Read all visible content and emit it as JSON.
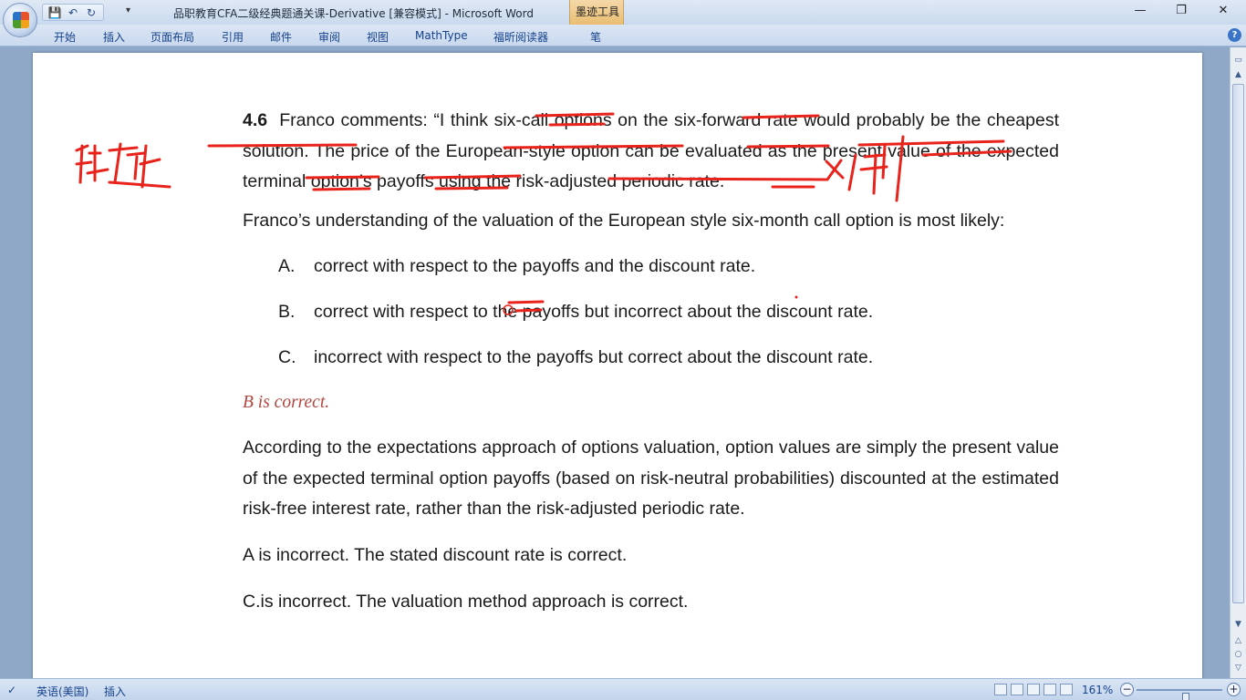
{
  "window": {
    "title": "品职教育CFA二级经典题通关课-Derivative [兼容模式] - Microsoft Word",
    "contextual_tab": "墨迹工具"
  },
  "quick_access": {
    "icons": [
      "save-icon",
      "undo-icon",
      "redo-icon"
    ],
    "more_label": "▾"
  },
  "ribbon": {
    "tabs": [
      "开始",
      "插入",
      "页面布局",
      "引用",
      "邮件",
      "审阅",
      "视图",
      "MathType",
      "福昕阅读器",
      "笔"
    ],
    "help_label": "?"
  },
  "document": {
    "question_number": "4.6",
    "question_text": "Franco comments: “I think six-call options on the six-forward rate would probably be the cheapest solution. The price of the European-style option can be evaluated as the present value of the expected terminal option’s payoffs using the risk-adjusted periodic rate.",
    "prompt": "Franco’s understanding of the valuation of the European style six-month call option is most likely:",
    "options": [
      {
        "label": "A.",
        "text": "correct with respect to the payoffs and the discount rate."
      },
      {
        "label": "B.",
        "text": "correct with respect to the payoffs but incorrect about the discount rate."
      },
      {
        "label": "C.",
        "text": "incorrect with respect to the payoffs but correct about the discount rate."
      }
    ],
    "answer": "B is correct.",
    "explanation": "According to the expectations approach of options valuation, option values are simply the present value of the expected terminal option payoffs (based on risk-neutral probabilities) discounted at the estimated risk-free interest rate, rather than the risk-adjusted periodic rate.",
    "note_a": "A is incorrect. The stated discount rate is correct.",
    "note_c": "C.is incorrect. The valuation method approach is correct."
  },
  "statusbar": {
    "language": "英语(美国)",
    "mode": "插入",
    "zoom": "161%",
    "zoom_fraction": 0.58
  },
  "colors": {
    "ink": "#e8231b",
    "answer": "#b4463f",
    "chrome": "#c9d9ee"
  }
}
